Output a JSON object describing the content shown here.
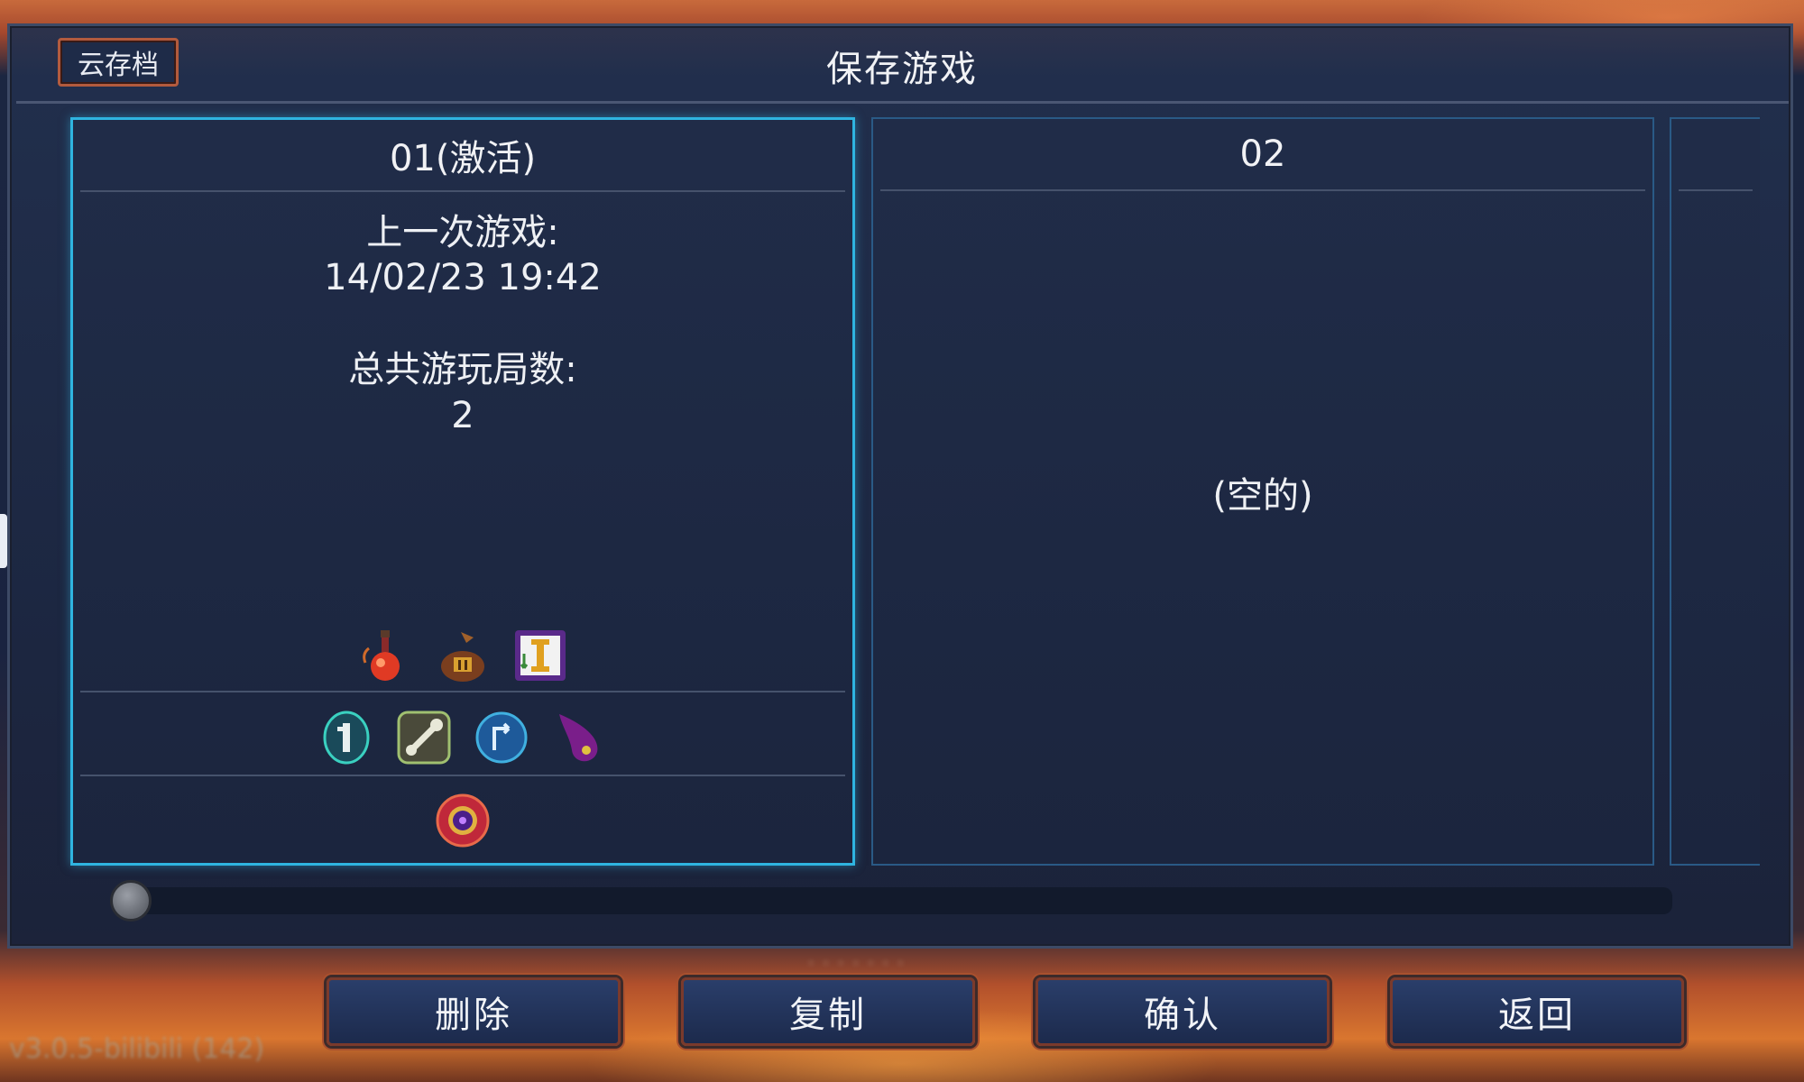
{
  "window": {
    "title": "保存游戏",
    "cloud_button": "云存档"
  },
  "slots": [
    {
      "header": "01(激活)",
      "active": true,
      "last_played_label": "上一次游戏:",
      "last_played_value": "14/02/23 19:42",
      "total_runs_label": "总共游玩局数:",
      "total_runs_value": "2",
      "row1_icons": [
        "health-potion-icon",
        "treasure-bag-icon",
        "tier-scroll-icon"
      ],
      "row2_icons": [
        "teal-rune-icon",
        "wrench-rune-icon",
        "blue-orb-rune-icon",
        "purple-flame-icon"
      ],
      "row3_icons": [
        "red-eye-amulet-icon"
      ]
    },
    {
      "header": "02",
      "active": false,
      "empty_text": "(空的)"
    }
  ],
  "buttons": {
    "delete": "删除",
    "copy": "复制",
    "confirm": "确认",
    "back": "返回"
  },
  "scrollbar": {
    "position": 0.0
  },
  "footer": {
    "version": "v3.0.5-bilibili (142)"
  },
  "colors": {
    "active_border": "#2fb4e0",
    "panel_bg": "#1f2b48",
    "button_border": "#a9502e"
  }
}
